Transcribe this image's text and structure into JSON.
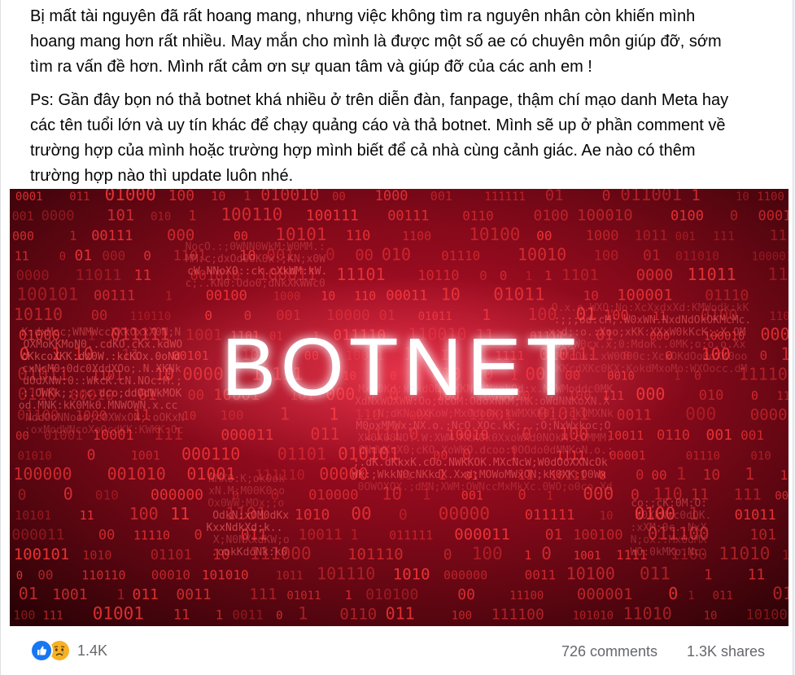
{
  "post": {
    "paragraphs": [
      [
        "Bị mất tài nguyên đã rất hoang mang, nhưng việc không tìm ra nguyên nhân còn khiến mình",
        "hoang mang hơn rất nhiều. May mắn cho mình là được một số ae có chuyên môn giúp đỡ, sớm",
        "tìm ra vấn đề hơn. Mình rất cảm ơn sự quan tâm và giúp đỡ của các anh em !"
      ],
      [
        "Ps: Gần đây bọn nó thả botnet khá nhiều ở trên diễn đàn, fanpage, thậm chí mạo danh Meta hay",
        "các tên tuổi lớn và uy tín khác để chạy quảng cáo và thả botnet. Mình sẽ up ở phần comment về",
        "trường hợp của mình hoặc trường hợp mình biết để cả nhà cùng cảnh giác. Ae nào có thêm",
        "trường hợp nào thì update luôn nhé."
      ]
    ]
  },
  "image": {
    "title_text": "BOTNET",
    "background_color": "#3a0408",
    "glow_color": "#c8102e",
    "digit_color": "#ff3b3b",
    "title_color": "#ffffff"
  },
  "stats": {
    "reaction_icons": [
      "like-icon",
      "sad-icon"
    ],
    "reaction_count": "1.4K",
    "comments": "726 comments",
    "shares": "1.3K shares",
    "like_color": "#1877f2",
    "sad_color": "#f7b125"
  }
}
